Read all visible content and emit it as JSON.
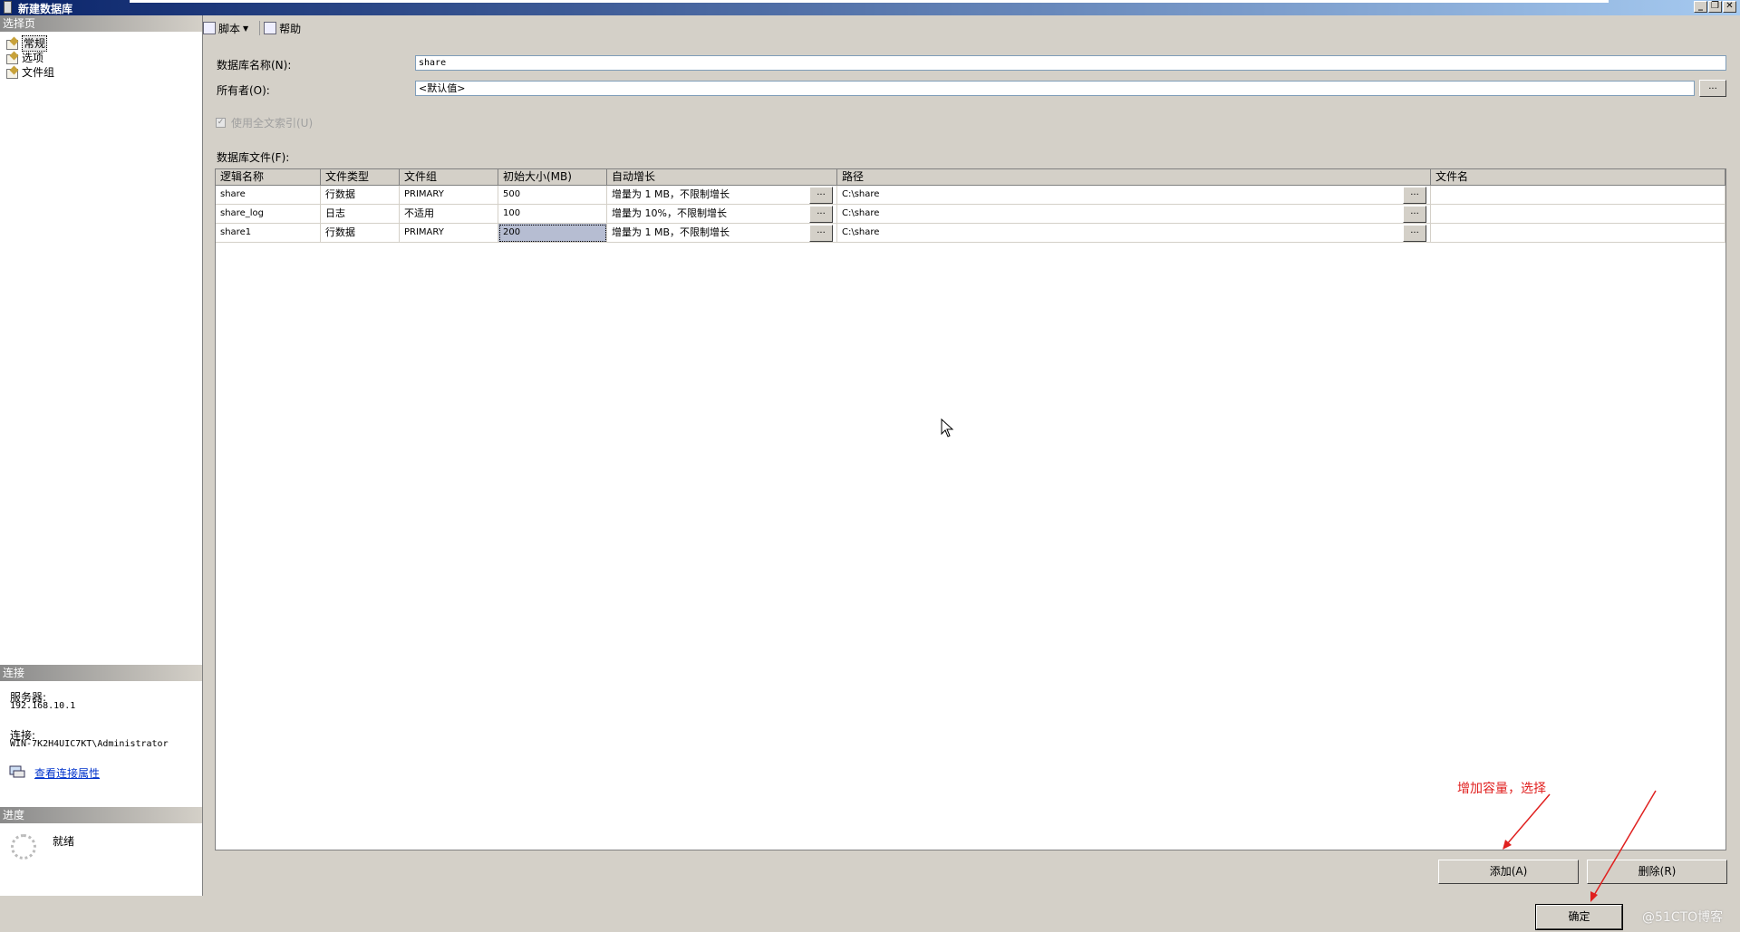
{
  "window": {
    "title": "新建数据库",
    "controls": [
      "minimize-icon",
      "restore-icon",
      "close-icon"
    ]
  },
  "sidebar": {
    "header": "选择页",
    "items": [
      {
        "label": "常规",
        "icon": "page-icon",
        "selected": true
      },
      {
        "label": "选项",
        "icon": "page-icon",
        "selected": false
      },
      {
        "label": "文件组",
        "icon": "page-icon",
        "selected": false
      }
    ]
  },
  "connection": {
    "header": "连接",
    "server_label": "服务器:",
    "server_value": "192.168.10.1",
    "connection_label": "连接:",
    "connection_value": "WIN-7K2H4UIC7KT\\Administrator",
    "link": "查看连接属性"
  },
  "progress": {
    "header": "进度",
    "status": "就绪"
  },
  "toolbar": {
    "script": "脚本",
    "help": "帮助"
  },
  "form": {
    "db_name_label": "数据库名称(N):",
    "db_name_value": "share",
    "owner_label": "所有者(O):",
    "owner_value": "<默认值>",
    "owner_browse": "...",
    "fulltext_label": "使用全文索引(U)",
    "fulltext_checked": true,
    "files_label": "数据库文件(F):"
  },
  "grid": {
    "columns": [
      "逻辑名称",
      "文件类型",
      "文件组",
      "初始大小(MB)",
      "自动增长",
      "路径",
      "文件名"
    ],
    "rows": [
      {
        "name": "share",
        "type": "行数据",
        "group": "PRIMARY",
        "size": "500",
        "growth": "增量为 1 MB，不限制增长",
        "path": "C:\\share",
        "file": ""
      },
      {
        "name": "share_log",
        "type": "日志",
        "group": "不适用",
        "size": "100",
        "growth": "增量为 10%，不限制增长",
        "path": "C:\\share",
        "file": ""
      },
      {
        "name": "share1",
        "type": "行数据",
        "group": "PRIMARY",
        "size": "200",
        "growth": "增量为 1 MB，不限制增长",
        "path": "C:\\share",
        "file": ""
      }
    ],
    "ellipsis": "..."
  },
  "buttons": {
    "add": "添加(A)",
    "delete": "删除(R)",
    "ok": "确定"
  },
  "annotation": "增加容量，选择",
  "watermark": "@51CTO博客",
  "colors": {
    "annotation": "#e0201f",
    "titlebar_start": "#0a246a",
    "selection": "#b6bdd2"
  }
}
